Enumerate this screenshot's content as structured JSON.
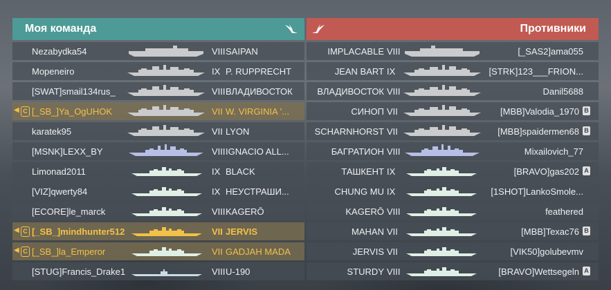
{
  "allies": {
    "title": "Моя команда",
    "rows": [
      {
        "player": "Nezabydka54",
        "tier": "VIII",
        "ship": "SAIPAN",
        "kind": "carrier",
        "state": "normal"
      },
      {
        "player": "Mopeneiro",
        "tier": "IX",
        "ship": "P. RUPPRECHT",
        "kind": "battleship",
        "state": "normal"
      },
      {
        "player": "[SWAT]smail134rus_",
        "tier": "VIII",
        "ship": "ВЛАДИВОСТОК",
        "kind": "battleship",
        "state": "normal"
      },
      {
        "player": "[_SB_]Ya_OgUHOK",
        "tier": "VII",
        "ship": "W. VIRGINIA '...",
        "kind": "battleship",
        "state": "division",
        "div": "C"
      },
      {
        "player": "karatek95",
        "tier": "VII",
        "ship": "LYON",
        "kind": "battleship",
        "state": "normal"
      },
      {
        "player": "[MSNK]LEXX_BY",
        "tier": "VIII",
        "ship": "IGNACIO ALL...",
        "kind": "cruiser",
        "state": "normal"
      },
      {
        "player": "Limonad2011",
        "tier": "IX",
        "ship": "BLACK",
        "kind": "destroyer",
        "state": "normal"
      },
      {
        "player": "[VIZ]qwerty84",
        "tier": "IX",
        "ship": "НЕУСТРАШИ...",
        "kind": "destroyer",
        "state": "normal"
      },
      {
        "player": "[ECORE]le_marck",
        "tier": "VIII",
        "ship": "KAGERŌ",
        "kind": "destroyer",
        "state": "normal"
      },
      {
        "player": "[_SB_]mindhunter512",
        "tier": "VII",
        "ship": "JERVIS",
        "kind": "destroyer",
        "state": "self",
        "div": "C"
      },
      {
        "player": "[_SB_]la_Emperor",
        "tier": "VII",
        "ship": "GADJAH MADA",
        "kind": "destroyer",
        "state": "division",
        "div": "C"
      },
      {
        "player": "[STUG]Francis_Drake1",
        "tier": "VIII",
        "ship": "U-190",
        "kind": "submarine",
        "state": "normal"
      }
    ]
  },
  "enemies": {
    "title": "Противники",
    "rows": [
      {
        "player": "[_SAS2]ama055",
        "tier": "VIII",
        "ship": "IMPLACABLE",
        "kind": "carrier",
        "badge": ""
      },
      {
        "player": "[STRK]123___FRION...",
        "tier": "IX",
        "ship": "JEAN BART",
        "kind": "battleship",
        "badge": ""
      },
      {
        "player": "Danil5688",
        "tier": "VIII",
        "ship": "ВЛАДИВОСТОК",
        "kind": "battleship",
        "badge": ""
      },
      {
        "player": "[MBB]Valodia_1970",
        "tier": "VII",
        "ship": "СИНОП",
        "kind": "battleship",
        "badge": "B"
      },
      {
        "player": "[MBB]spaidermen68",
        "tier": "VII",
        "ship": "SCHARNHORST",
        "kind": "battleship",
        "badge": "B"
      },
      {
        "player": "Mixailovich_77",
        "tier": "VIII",
        "ship": "БАГРАТИОН",
        "kind": "cruiser",
        "badge": ""
      },
      {
        "player": "[BRAVO]gas202",
        "tier": "IX",
        "ship": "ТАШКЕНТ",
        "kind": "destroyer",
        "badge": "A"
      },
      {
        "player": "[1SHOT]LankoSmole...",
        "tier": "IX",
        "ship": "CHUNG MU",
        "kind": "destroyer",
        "badge": ""
      },
      {
        "player": "feathered",
        "tier": "VIII",
        "ship": "KAGERŌ",
        "kind": "destroyer",
        "badge": ""
      },
      {
        "player": "[MBB]Texac76",
        "tier": "VII",
        "ship": "MAHAN",
        "kind": "destroyer",
        "badge": "B"
      },
      {
        "player": "[VIK50]golubevmv",
        "tier": "VII",
        "ship": "JERVIS",
        "kind": "destroyer",
        "badge": ""
      },
      {
        "player": "[BRAVO]Wettsegeln",
        "tier": "VIII",
        "ship": "STURDY",
        "kind": "destroyer",
        "badge": "A"
      }
    ]
  },
  "colors": {
    "carrier": "#c9cbcd",
    "battleship": "#c9cbcd",
    "cruiser": "#b7bfe6",
    "destroyer": "#dfefe6",
    "submarine": "#c9dbe6",
    "self_ship": "#f2c14a"
  },
  "icons": {
    "header": "bird-icon",
    "division": "division-icon",
    "voice": "speaker-icon"
  }
}
